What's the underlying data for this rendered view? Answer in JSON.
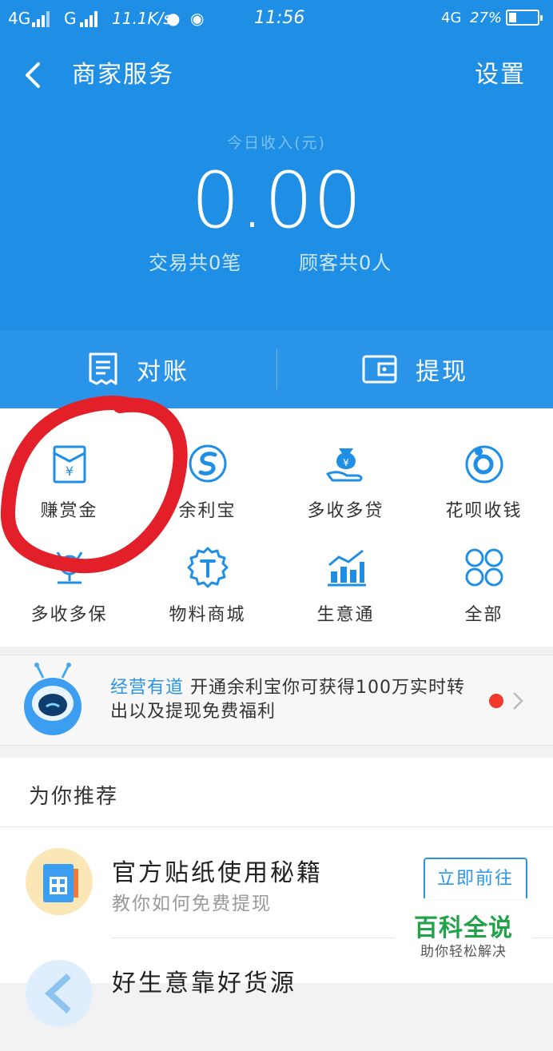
{
  "status_bar": {
    "network_left": "4G",
    "network_mid": "G",
    "speed": "11.1K/s",
    "time": "11:56",
    "network_right": "4G",
    "battery": "27%",
    "battery_level": 0.27
  },
  "header": {
    "title": "商家服务",
    "settings_label": "设置",
    "income_label": "今日收入(元)",
    "income_value": "0.00",
    "transactions": "交易共0笔",
    "customers": "顾客共0人"
  },
  "actions": [
    {
      "label": "对账",
      "icon": "receipt-icon"
    },
    {
      "label": "提现",
      "icon": "wallet-icon"
    }
  ],
  "grid": [
    {
      "label": "赚赏金",
      "icon": "red-envelope-icon"
    },
    {
      "label": "余利宝",
      "icon": "yulibao-icon"
    },
    {
      "label": "多收多贷",
      "icon": "money-bag-hand-icon"
    },
    {
      "label": "花呗收钱",
      "icon": "huabei-icon"
    },
    {
      "label": "多收多保",
      "icon": "shield-person-icon"
    },
    {
      "label": "物料商城",
      "icon": "t-badge-icon"
    },
    {
      "label": "生意通",
      "icon": "bar-chart-icon"
    },
    {
      "label": "全部",
      "icon": "four-petal-icon"
    }
  ],
  "banner": {
    "highlight": "经营有道",
    "text": "开通余利宝你可获得100万实时转出以及提现免费福利"
  },
  "recommend": {
    "title": "为你推荐",
    "items": [
      {
        "name": "官方贴纸使用秘籍",
        "desc": "教你如何免费提现",
        "button": "立即前往"
      },
      {
        "name": "好生意靠好货源",
        "desc": "",
        "button": ""
      }
    ]
  },
  "watermark": {
    "big": "百科全说",
    "small": "助你轻松解决"
  },
  "colors": {
    "primary": "#1f8fe6",
    "accent": "#2a95e8",
    "annotation": "#e3202a",
    "red_dot": "#f03b2c",
    "watermark": "#22a34a"
  }
}
